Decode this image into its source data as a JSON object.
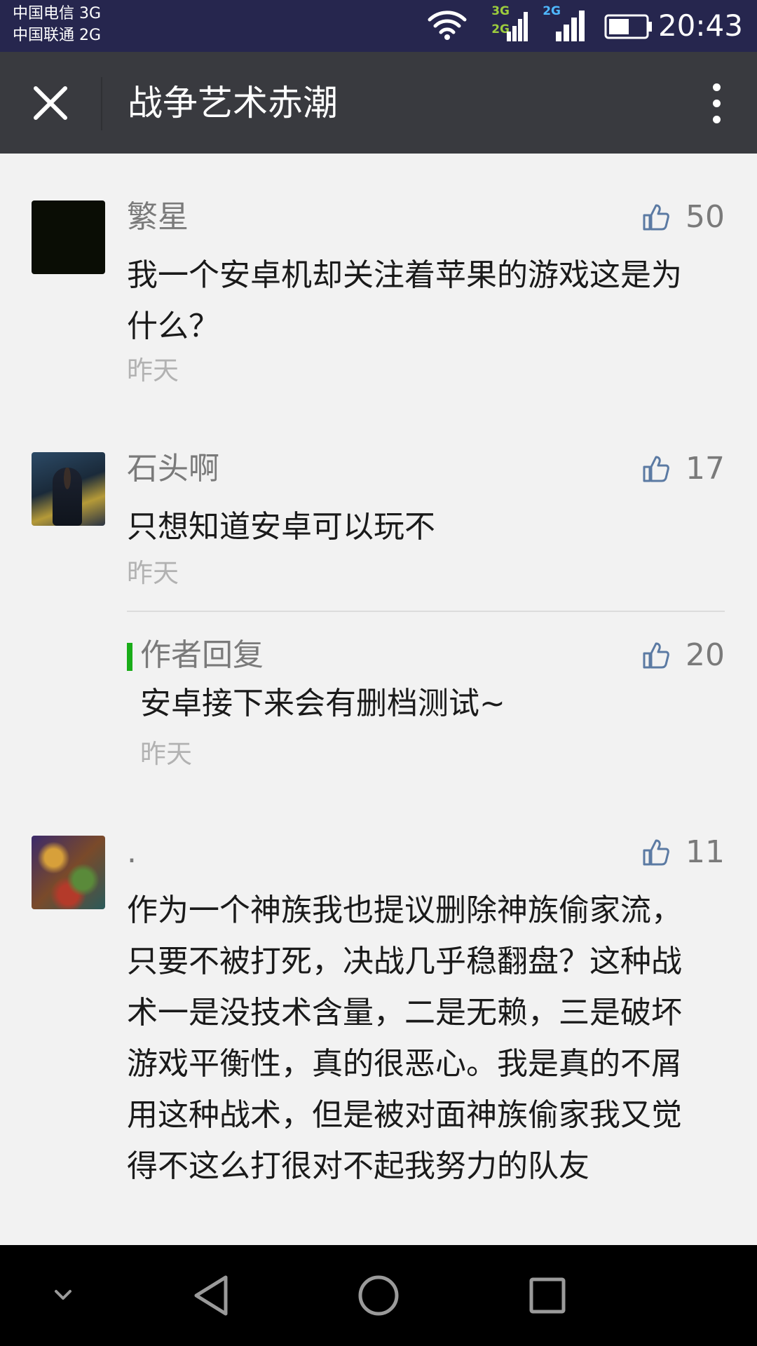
{
  "status_bar": {
    "carrier_1": "中国电信 3G",
    "carrier_2": "中国联通 2G",
    "net_1_top": "3G",
    "net_1_bottom": "2G",
    "net_2": "2G",
    "time": "20:43",
    "icons": [
      "wifi-icon",
      "signal-icon",
      "signal-icon",
      "battery-icon"
    ]
  },
  "header": {
    "title": "战争艺术赤潮",
    "close_icon": "close-icon",
    "more_icon": "more-vertical-icon",
    "background": "#393a3f"
  },
  "comments": [
    {
      "name": "繁星",
      "text": "我一个安卓机却关注着苹果的游戏这是为什么？",
      "time": "昨天",
      "likes": "50"
    },
    {
      "name": "石头啊",
      "text": "只想知道安卓可以玩不",
      "time": "昨天",
      "likes": "17",
      "reply": {
        "label": "作者回复",
        "text": "安卓接下来会有删档测试~",
        "time": "昨天",
        "likes": "20"
      }
    },
    {
      "name": ".",
      "text": "作为一个神族我也提议删除神族偷家流，只要不被打死，决战几乎稳翻盘？这种战术一是没技术含量，二是无赖，三是破坏游戏平衡性，真的很恶心。我是真的不屑用这种战术，但是被对面神族偷家我又觉得不这么打很对不起我努力的队友",
      "likes": "11"
    }
  ],
  "nav_bar": {
    "icons": [
      "hide-keyboard-icon",
      "back-icon",
      "home-icon",
      "recent-apps-icon"
    ]
  },
  "colors": {
    "status_bar": "#26264e",
    "reply_accent": "#1aad19",
    "like_icon": "#5b7aa3",
    "page_background": "#f2f2f2"
  }
}
